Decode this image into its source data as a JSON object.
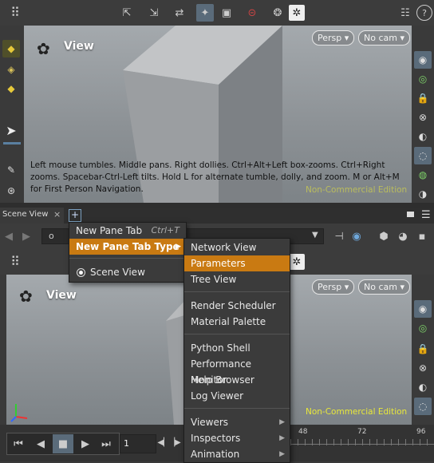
{
  "top_toolbar": {
    "icons": [
      "grid-menu-icon",
      "select-arrow-icon",
      "move-arrow-icon",
      "rotate-handle-icon",
      "display-options-icon",
      "snapshot-icon",
      "no-entry-icon",
      "lights-icon",
      "gear-icon",
      "layout-icon",
      "help-icon"
    ]
  },
  "viewport_top": {
    "title": "View",
    "persp": "Persp",
    "cam": "No cam",
    "hint": "Left mouse tumbles. Middle pans. Right dollies. Ctrl+Alt+Left box-zooms. Ctrl+Right zooms. Spacebar-Ctrl-Left tilts. Hold L for alternate tumble, dolly, and zoom. M or Alt+M for First Person Navigation.",
    "watermark": "Non-Commercial Edition"
  },
  "pane_tab": {
    "label": "Scene View",
    "close": "×",
    "add": "+"
  },
  "context_menu": {
    "items": [
      {
        "label": "New Pane Tab",
        "shortcut": "Ctrl+T"
      },
      {
        "label": "New Pane Tab Type",
        "arrow": "▶"
      },
      {
        "label": "Scene View"
      }
    ]
  },
  "submenu": {
    "items": [
      "Network View",
      "Parameters",
      "Tree View",
      "Render Scheduler",
      "Material Palette",
      "Python Shell",
      "Performance Monitor",
      "Help Browser",
      "Log Viewer",
      "Viewers",
      "Inspectors",
      "Animation"
    ],
    "arrow": "▶"
  },
  "viewport_bottom": {
    "title": "View",
    "persp": "Persp",
    "cam": "No cam",
    "watermark": "Non-Commercial Edition"
  },
  "timeline": {
    "frame": "1",
    "ticks": [
      "48",
      "72",
      "96"
    ]
  },
  "address_bar": {
    "prefix": "o"
  }
}
